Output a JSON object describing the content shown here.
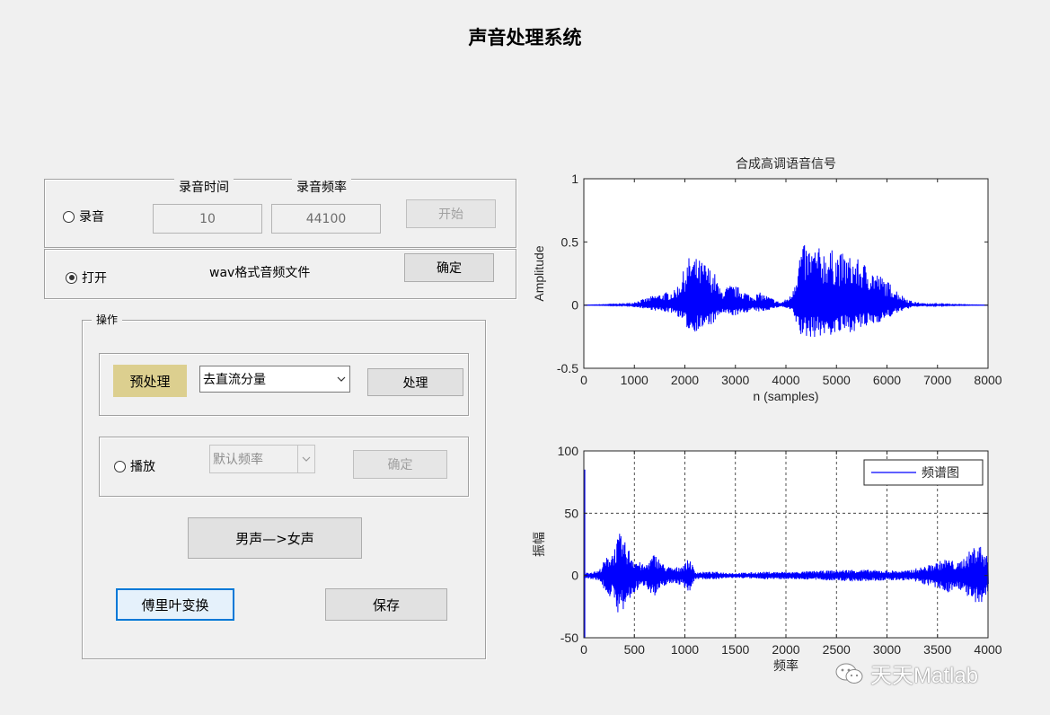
{
  "window": {
    "title": "声音处理系统"
  },
  "record_panel": {
    "record_time_label": "录音时间",
    "record_rate_label": "录音频率",
    "record_radio_label": "录音",
    "record_time_value": "10",
    "record_rate_value": "44100",
    "start_button": "开始",
    "open_radio_label": "打开",
    "file_label": "wav格式音频文件",
    "confirm_button": "确定"
  },
  "operation_panel": {
    "title": "操作",
    "preprocess_label": "预处理",
    "preprocess_select": "去直流分量",
    "process_button": "处理",
    "play_radio_label": "播放",
    "play_select": "默认频率",
    "play_confirm_button": "确定",
    "voice_button": "男声—>女声",
    "fourier_button": "傅里叶变换",
    "save_button": "保存"
  },
  "watermark": {
    "text": "天天Matlab"
  },
  "colors": {
    "accent": "#0000ff",
    "preprocess_bg": "#dccf8f",
    "focus": "#0078d7"
  },
  "chart_data": [
    {
      "type": "line",
      "title": "合成高调语音信号",
      "xlabel": "n (samples)",
      "ylabel": "Amplitude",
      "xlim": [
        0,
        8000
      ],
      "ylim": [
        -0.5,
        1
      ],
      "xticks": [
        "0",
        "1000",
        "2000",
        "3000",
        "4000",
        "5000",
        "6000",
        "7000",
        "8000"
      ],
      "yticks": [
        "1",
        "0.5",
        "0",
        "-0.5"
      ],
      "grid": false,
      "series": [
        {
          "color": "#0000ff",
          "envelope": [
            [
              0,
              0.0
            ],
            [
              900,
              0.01
            ],
            [
              1000,
              0.03
            ],
            [
              1200,
              0.05
            ],
            [
              1400,
              0.08
            ],
            [
              1600,
              0.1
            ],
            [
              1800,
              0.12
            ],
            [
              1900,
              0.2
            ],
            [
              2000,
              0.3
            ],
            [
              2100,
              0.4
            ],
            [
              2200,
              0.38
            ],
            [
              2400,
              0.34
            ],
            [
              2600,
              0.25
            ],
            [
              2700,
              0.12
            ],
            [
              2900,
              0.16
            ],
            [
              3100,
              0.14
            ],
            [
              3300,
              0.08
            ],
            [
              3500,
              0.1
            ],
            [
              3700,
              0.06
            ],
            [
              3900,
              0.02
            ],
            [
              4100,
              0.08
            ],
            [
              4300,
              0.48
            ],
            [
              4600,
              0.46
            ],
            [
              4900,
              0.44
            ],
            [
              5200,
              0.4
            ],
            [
              5500,
              0.35
            ],
            [
              5800,
              0.26
            ],
            [
              6100,
              0.16
            ],
            [
              6300,
              0.08
            ],
            [
              6500,
              0.03
            ],
            [
              6800,
              0.01
            ],
            [
              8000,
              0.0
            ]
          ],
          "negative_scale": 0.55
        }
      ]
    },
    {
      "type": "line",
      "title": "",
      "xlabel": "频率",
      "ylabel": "振幅",
      "xlim": [
        0,
        4000
      ],
      "ylim": [
        -50,
        100
      ],
      "xticks": [
        "0",
        "500",
        "1000",
        "1500",
        "2000",
        "2500",
        "3000",
        "3500",
        "4000"
      ],
      "yticks": [
        "100",
        "50",
        "0",
        "-50"
      ],
      "grid": true,
      "legend": "top-right",
      "series": [
        {
          "name": "频谱图",
          "color": "#0000ff",
          "envelope": [
            [
              0,
              2
            ],
            [
              150,
              4
            ],
            [
              200,
              12
            ],
            [
              300,
              22
            ],
            [
              350,
              34
            ],
            [
              400,
              28
            ],
            [
              500,
              14
            ],
            [
              600,
              8
            ],
            [
              700,
              18
            ],
            [
              800,
              8
            ],
            [
              900,
              6
            ],
            [
              1000,
              10
            ],
            [
              1050,
              14
            ],
            [
              1100,
              3
            ],
            [
              1300,
              3
            ],
            [
              1500,
              2
            ],
            [
              1800,
              3
            ],
            [
              2100,
              3
            ],
            [
              2400,
              4
            ],
            [
              2700,
              5
            ],
            [
              3000,
              4
            ],
            [
              3200,
              4
            ],
            [
              3400,
              8
            ],
            [
              3600,
              14
            ],
            [
              3700,
              10
            ],
            [
              3800,
              18
            ],
            [
              3900,
              28
            ],
            [
              4000,
              14
            ]
          ],
          "spikes": [
            [
              0,
              85
            ],
            [
              0,
              -50
            ]
          ]
        }
      ]
    }
  ]
}
